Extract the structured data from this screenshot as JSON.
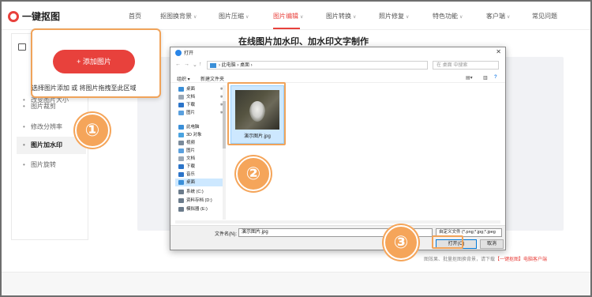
{
  "app": {
    "logo_text": "一键抠图"
  },
  "nav": {
    "items": [
      {
        "label": "首页",
        "caret": false,
        "active": false
      },
      {
        "label": "抠图换背景",
        "caret": true,
        "active": false
      },
      {
        "label": "图片压缩",
        "caret": true,
        "active": false
      },
      {
        "label": "图片编辑",
        "caret": true,
        "active": true
      },
      {
        "label": "图片转换",
        "caret": true,
        "active": false
      },
      {
        "label": "照片修复",
        "caret": true,
        "active": false
      },
      {
        "label": "特色功能",
        "caret": true,
        "active": false
      },
      {
        "label": "客户端",
        "caret": true,
        "active": false
      },
      {
        "label": "常见问题",
        "caret": false,
        "active": false
      }
    ],
    "caret_glyph": "∨"
  },
  "sidebar": {
    "items": [
      {
        "label": "改变图片大小",
        "active": false
      },
      {
        "label": "图片裁剪",
        "active": false
      },
      {
        "label": "修改分辨率",
        "active": false
      },
      {
        "label": "图片加水印",
        "active": true
      },
      {
        "label": "图片旋转",
        "active": false
      }
    ]
  },
  "main": {
    "title": "在线图片加水印、加水印文字制作",
    "add_button": "+ 添加图片",
    "hint": "选择图片添加 或 将图片拖拽至此区域",
    "footer_text": "图效果、批量抠图换背景，请下载",
    "footer_link": "【一键抠图】电脑客户端"
  },
  "badges": [
    "①",
    "②",
    "③"
  ],
  "dialog": {
    "title": "打开",
    "close_glyph": "✕",
    "address": "› 此电脑 › 桌面 ›",
    "search_placeholder": "在 桌面 中搜索",
    "toolbar_organize": "组织 ▾",
    "toolbar_new_folder": "新建文件夹",
    "nav_nodes": [
      {
        "label": "桌面",
        "color": "#3a8fd8",
        "pinned": true,
        "selected": false
      },
      {
        "label": "文档",
        "color": "#9aa7b5",
        "pinned": true,
        "selected": false
      },
      {
        "label": "下载",
        "color": "#2b74c9",
        "pinned": true,
        "selected": false
      },
      {
        "label": "图片",
        "color": "#5aa0de",
        "pinned": true,
        "selected": false
      },
      {
        "label": "此电脑",
        "color": "#3a8fd8",
        "pinned": false,
        "selected": false
      },
      {
        "label": "3D 对象",
        "color": "#4aa3e0",
        "pinned": false,
        "selected": false
      },
      {
        "label": "视频",
        "color": "#7a8a9a",
        "pinned": false,
        "selected": false
      },
      {
        "label": "图片",
        "color": "#5aa0de",
        "pinned": false,
        "selected": false
      },
      {
        "label": "文档",
        "color": "#9aa7b5",
        "pinned": false,
        "selected": false
      },
      {
        "label": "下载",
        "color": "#2b74c9",
        "pinned": false,
        "selected": false
      },
      {
        "label": "音乐",
        "color": "#2b74c9",
        "pinned": false,
        "selected": false
      },
      {
        "label": "桌面",
        "color": "#3a8fd8",
        "pinned": false,
        "selected": true
      },
      {
        "label": "系统 (C:)",
        "color": "#6b7b8b",
        "pinned": false,
        "selected": false
      },
      {
        "label": "资料存档 (D:)",
        "color": "#6b7b8b",
        "pinned": false,
        "selected": false
      },
      {
        "label": "模拟器 (E:)",
        "color": "#6b7b8b",
        "pinned": false,
        "selected": false
      }
    ],
    "file_name_thumb": "演示图片.jpg",
    "file_name_label": "文件名(N):",
    "file_name_value": "演示图片.jpg",
    "filter_value": "自定义文件 (*.png;*.jpg;*.jpeg",
    "open_button": "打开(O)",
    "cancel_button": "取消"
  }
}
